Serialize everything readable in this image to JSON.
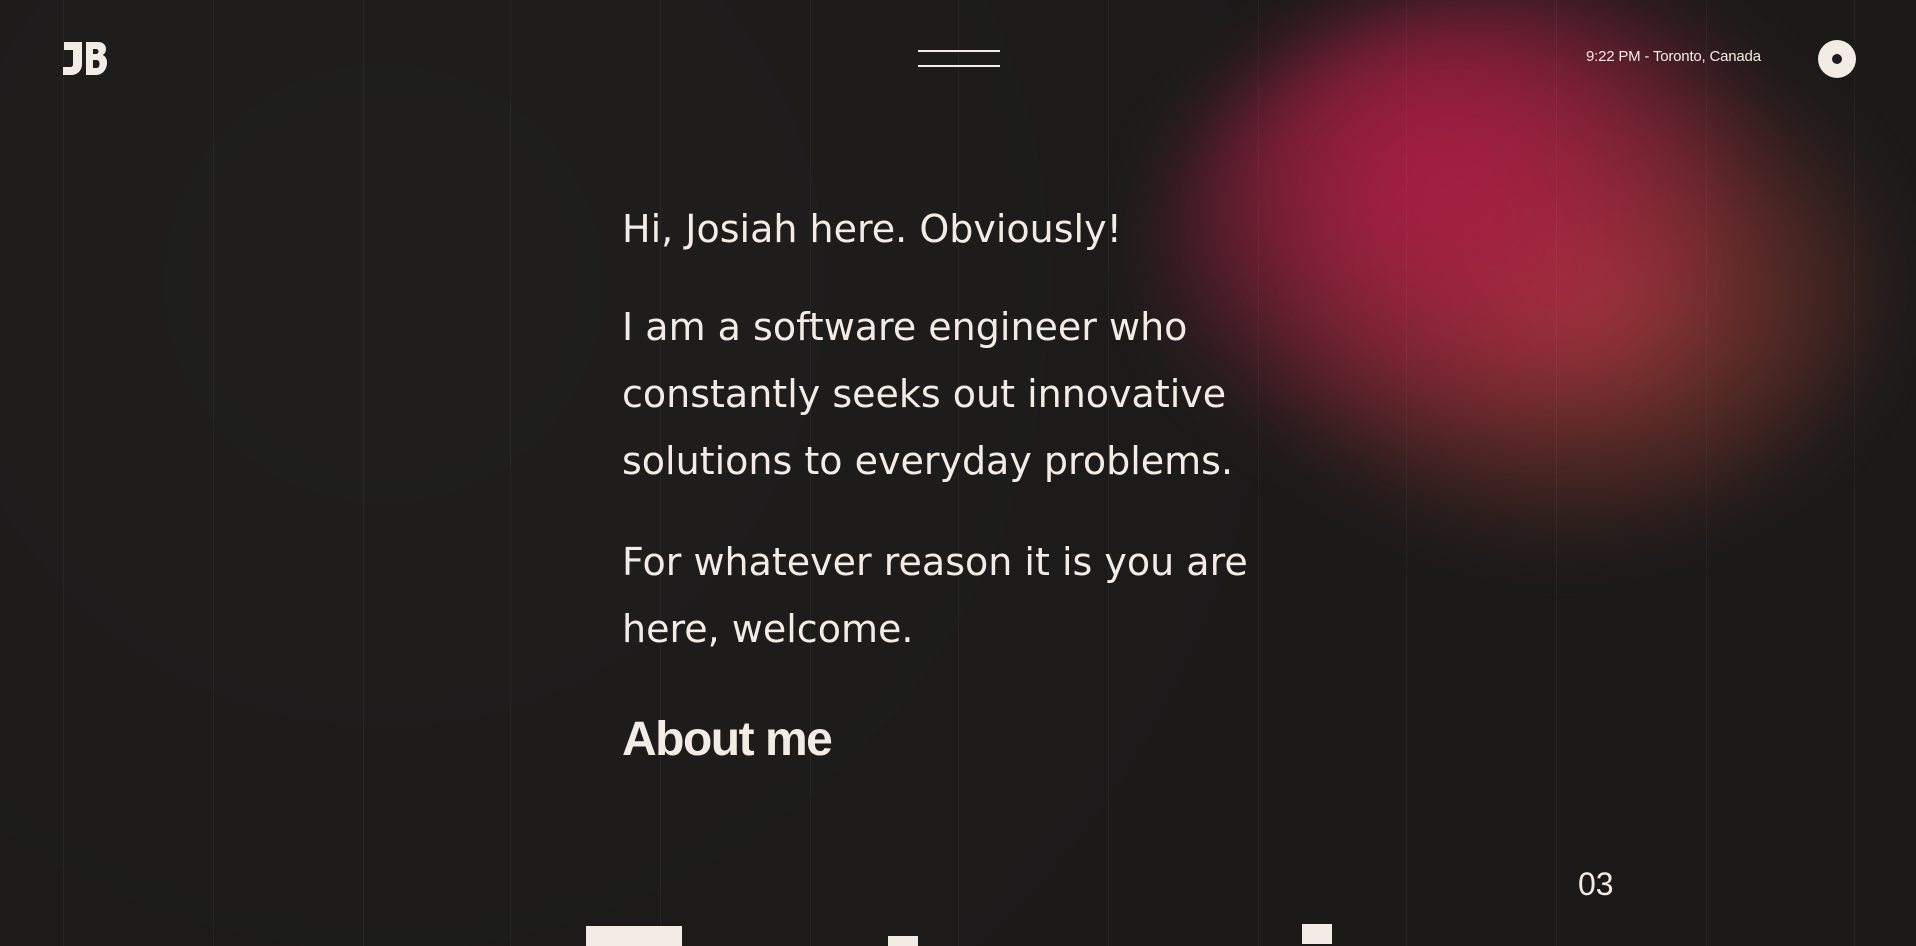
{
  "header": {
    "logo_text": "JB",
    "clock": "9:22 PM - Toronto, Canada"
  },
  "intro": {
    "greeting": "Hi, Josiah here. Obviously!",
    "bio": "I am a software engineer who constantly seeks out innovative solutions to everyday problems.",
    "welcome": "For whatever reason it is you are here, welcome."
  },
  "links": {
    "about": "About me"
  },
  "section": {
    "number": "03"
  },
  "colors": {
    "background": "#1c1b1a",
    "text": "#f3ece4",
    "glow_pink": "#c41c4e",
    "glow_coral": "#d64e48"
  }
}
